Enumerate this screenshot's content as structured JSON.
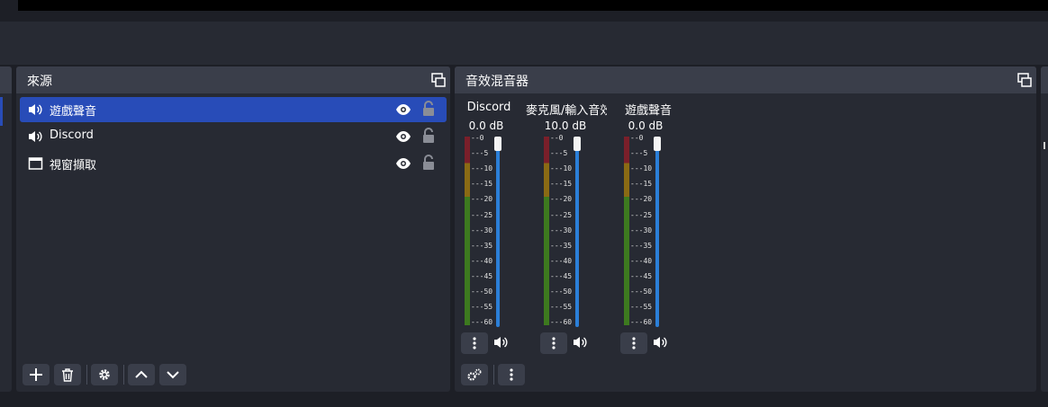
{
  "colors": {
    "background": "#1d1f26",
    "panel": "#272a33",
    "header": "#3a3e4a",
    "selection": "#284cb8",
    "fader": "#2b7fd8",
    "meter_green": "#3d7a1f",
    "meter_yellow": "#8a6a14",
    "meter_red": "#7a1f2a"
  },
  "sources_dock": {
    "title": "來源",
    "items": [
      {
        "label": "遊戲聲音",
        "icon": "speaker-icon",
        "selected": true
      },
      {
        "label": "Discord",
        "icon": "speaker-icon",
        "selected": false
      },
      {
        "label": "視窗擷取",
        "icon": "window-icon",
        "selected": false
      }
    ],
    "toolbar": [
      "add-icon",
      "trash-icon",
      "gear-icon",
      "chevron-up-icon",
      "chevron-down-icon"
    ]
  },
  "mixer_dock": {
    "title": "音效混音器",
    "ticks": [
      "0",
      "-5",
      "-10",
      "-15",
      "-20",
      "-25",
      "-30",
      "-35",
      "-40",
      "-45",
      "-50",
      "-55",
      "-60"
    ],
    "channels": [
      {
        "name": "Discord",
        "db": "0.0 dB",
        "fader_level": 1.0
      },
      {
        "name": "麥克風/輸入音效 ’",
        "db": "10.0 dB",
        "fader_level": 1.0
      },
      {
        "name": "遊戲聲音",
        "db": "0.0 dB",
        "fader_level": 1.0
      }
    ]
  }
}
